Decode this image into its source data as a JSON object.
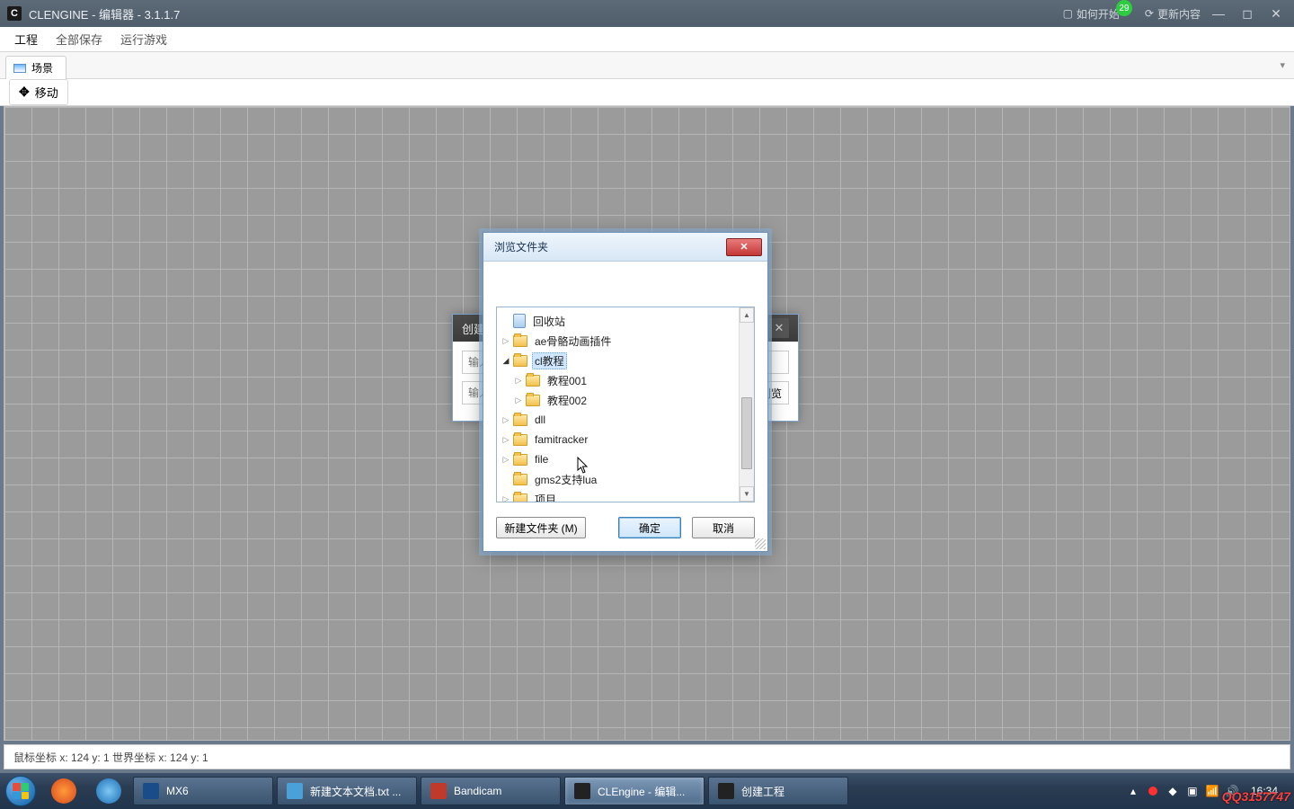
{
  "titlebar": {
    "app_logo": "C",
    "title": "CLENGINE - 编辑器 - 3.1.1.7",
    "help_label": "如何开始",
    "update_label": "更新内容",
    "badge": "29"
  },
  "menubar": {
    "items": [
      "工程",
      "全部保存",
      "运行游戏"
    ]
  },
  "tab": {
    "label": "场景"
  },
  "toolbar": {
    "move_label": "移动"
  },
  "statusbar": {
    "text": "鼠标坐标 x: 124 y: 1 世界坐标 x: 124 y: 1"
  },
  "create_dialog": {
    "title": "创建",
    "placeholder1": "输入",
    "placeholder2": "输入",
    "browse": "浏览"
  },
  "browse_dialog": {
    "title": "浏览文件夹",
    "tree": [
      {
        "label": "回收站",
        "icon": "recycle",
        "indent": 0,
        "arrow": ""
      },
      {
        "label": "ae骨骼动画插件",
        "icon": "folder",
        "indent": 0,
        "arrow": "▷"
      },
      {
        "label": "cl教程",
        "icon": "folder",
        "indent": 0,
        "arrow": "◢",
        "selected": true
      },
      {
        "label": "教程001",
        "icon": "folder",
        "indent": 1,
        "arrow": "▷"
      },
      {
        "label": "教程002",
        "icon": "folder",
        "indent": 1,
        "arrow": "▷"
      },
      {
        "label": "dll",
        "icon": "folder",
        "indent": 0,
        "arrow": "▷"
      },
      {
        "label": "famitracker",
        "icon": "folder",
        "indent": 0,
        "arrow": "▷"
      },
      {
        "label": "file",
        "icon": "folder",
        "indent": 0,
        "arrow": "▷"
      },
      {
        "label": "gms2支持lua",
        "icon": "folder",
        "indent": 0,
        "arrow": ""
      },
      {
        "label": "项目",
        "icon": "folder",
        "indent": 0,
        "arrow": "▷"
      }
    ],
    "new_folder": "新建文件夹 (M)",
    "ok": "确定",
    "cancel": "取消"
  },
  "taskbar": {
    "items": [
      {
        "label": "MX6",
        "color": "#1a4c8a"
      },
      {
        "label": "新建文本文档.txt ...",
        "color": "#4aa0d8"
      },
      {
        "label": "Bandicam",
        "color": "#c0392b"
      },
      {
        "label": "CLEngine - 编辑...",
        "color": "#222",
        "active": true
      },
      {
        "label": "创建工程",
        "color": "#222"
      }
    ],
    "clock": "16:34"
  },
  "watermark": "QQ3157747"
}
